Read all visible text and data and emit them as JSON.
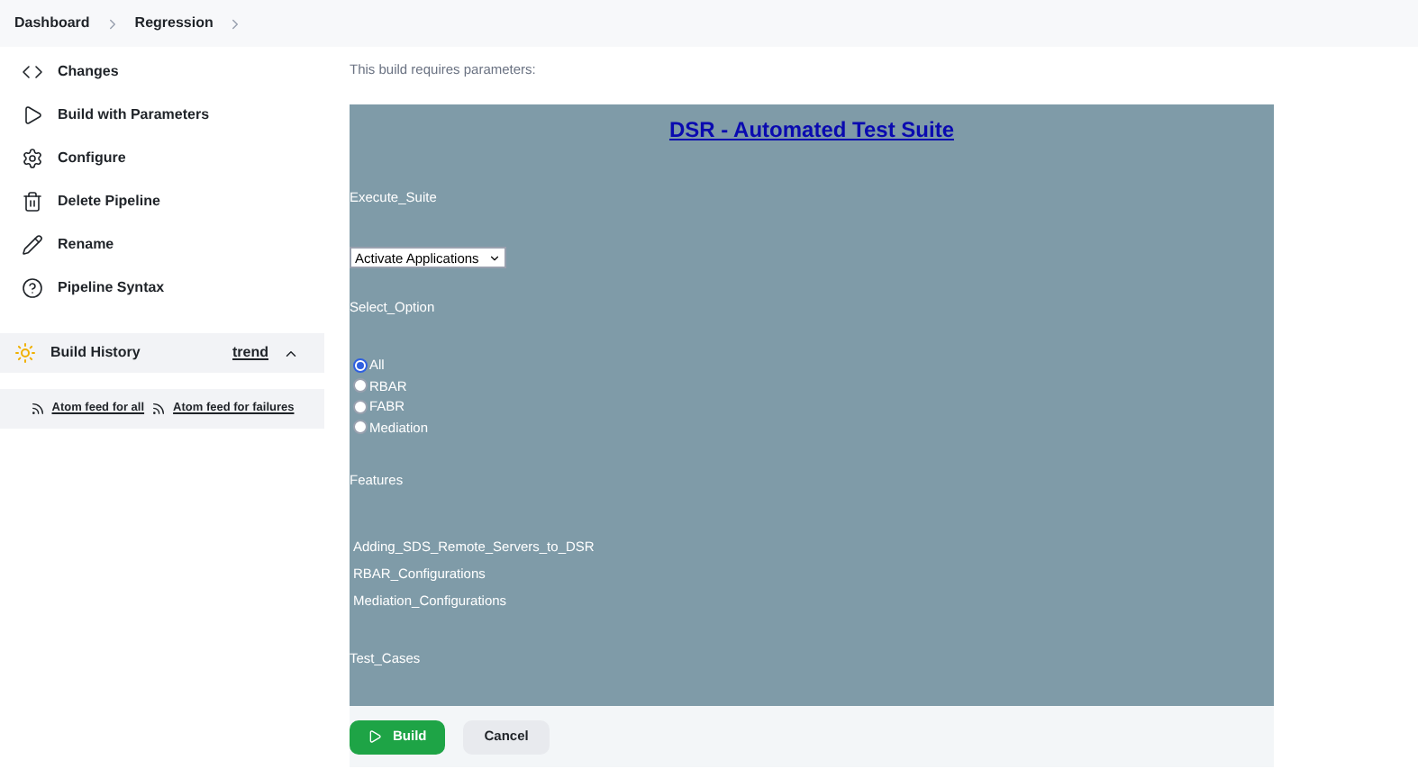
{
  "breadcrumbs": [
    "Dashboard",
    "Regression"
  ],
  "sidebar": {
    "items": [
      {
        "kind": "code",
        "label": "Changes"
      },
      {
        "kind": "play",
        "label": "Build with Parameters"
      },
      {
        "kind": "gear",
        "label": "Configure"
      },
      {
        "kind": "trash",
        "label": "Delete Pipeline"
      },
      {
        "kind": "pencil",
        "label": "Rename"
      },
      {
        "kind": "help",
        "label": "Pipeline Syntax"
      }
    ]
  },
  "build_history": {
    "title": "Build History",
    "trend_link": "trend",
    "expanded": true,
    "feeds": [
      "Atom feed for all",
      "Atom feed for failures"
    ]
  },
  "intro": "This build requires parameters:",
  "form": {
    "title": "DSR - Automated Test Suite",
    "execute_suite": {
      "label": "Execute_Suite",
      "value": "Activate Applications"
    },
    "select_option": {
      "label": "Select_Option",
      "options": [
        {
          "label": "All",
          "selected": true
        },
        {
          "label": "RBAR",
          "selected": false
        },
        {
          "label": "FABR",
          "selected": false
        },
        {
          "label": "Mediation",
          "selected": false
        }
      ]
    },
    "features": {
      "label": "Features",
      "items": [
        "Adding_SDS_Remote_Servers_to_DSR",
        "RBAR_Configurations",
        "Mediation_Configurations"
      ]
    },
    "test_cases": {
      "label": "Test_Cases"
    }
  },
  "buttons": {
    "build": "Build",
    "cancel": "Cancel"
  }
}
